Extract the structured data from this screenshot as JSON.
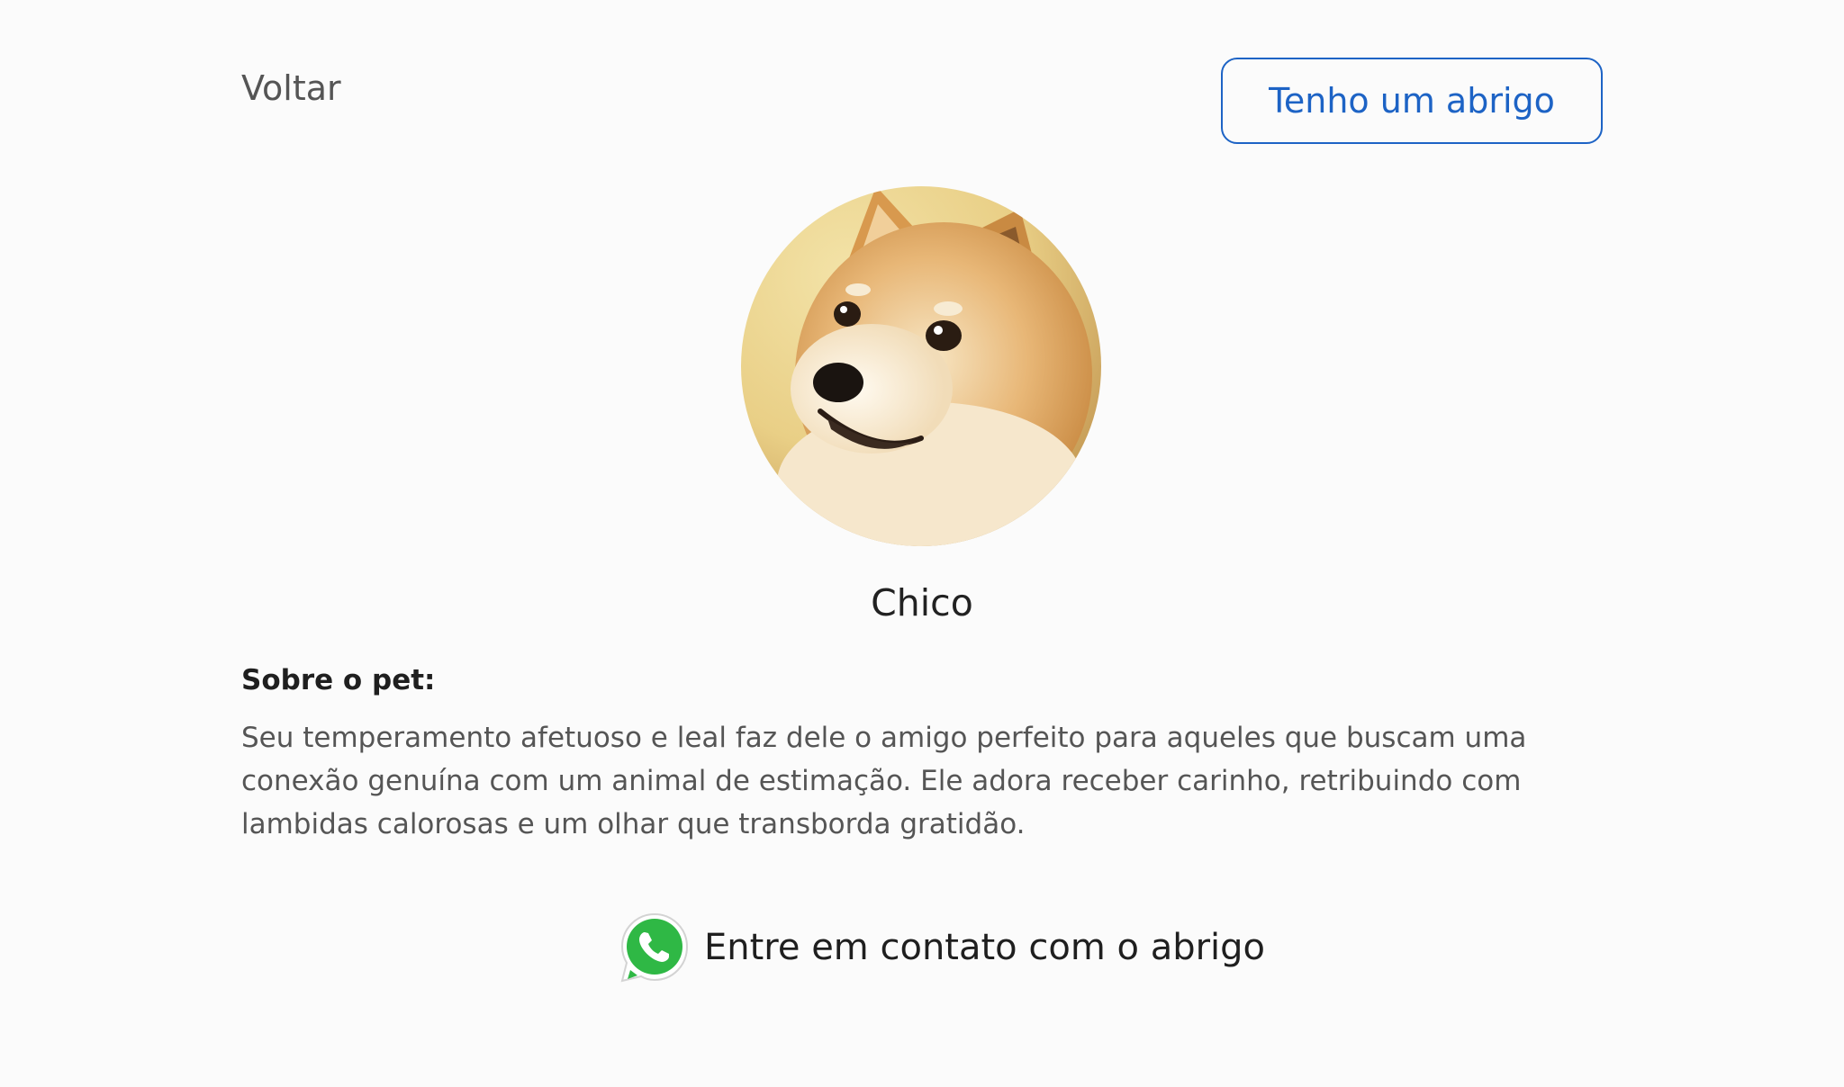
{
  "header": {
    "back_label": "Voltar",
    "shelter_button_label": "Tenho um abrigo"
  },
  "pet": {
    "name": "Chico",
    "photo_icon": "shiba-inu-dog-photo",
    "about_title": "Sobre o pet:",
    "about_text": "Seu temperamento afetuoso e leal faz dele o amigo perfeito para aqueles que buscam uma conexão genuína com um animal de estimação. Ele adora receber carinho, retribuindo com lambidas calorosas e um olhar que transborda gratidão."
  },
  "contact": {
    "icon": "whatsapp-icon",
    "label": "Entre em contato com o abrigo"
  },
  "colors": {
    "accent": "#1d63c5",
    "whatsapp": "#2fb845",
    "background": "#fbfbfb"
  }
}
